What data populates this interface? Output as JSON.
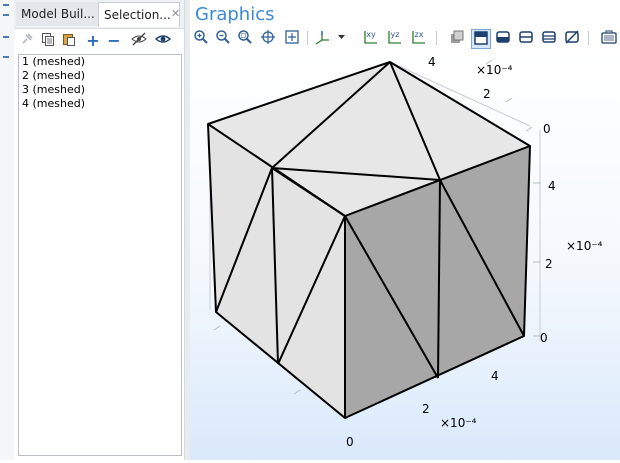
{
  "left_panel": {
    "tabs": [
      {
        "label": "Model Buil..."
      },
      {
        "label": "Selection..."
      }
    ],
    "close_label": "✕",
    "items": [
      {
        "label": "1 (meshed)"
      },
      {
        "label": "2 (meshed)"
      },
      {
        "label": "3 (meshed)"
      },
      {
        "label": "4 (meshed)"
      }
    ]
  },
  "graphics": {
    "title": "Graphics",
    "toolbar": {
      "xy": "xy",
      "yz": "yz",
      "zx": "zx"
    },
    "axes": {
      "right_y": {
        "ticks": [
          "4",
          "2",
          "0"
        ],
        "scale": "×10⁻⁴"
      },
      "right_z": {
        "ticks": [
          "4",
          "2",
          "0"
        ],
        "scale": "×10⁻⁴"
      },
      "bottom_x": {
        "ticks": [
          "4",
          "2",
          "0"
        ],
        "scale": "×10⁻⁴"
      }
    }
  },
  "colors": {
    "accent": "#3b8ad9",
    "face_light": "#e6e6e6",
    "face_dark": "#a6a6a6",
    "edge": "#000000"
  }
}
